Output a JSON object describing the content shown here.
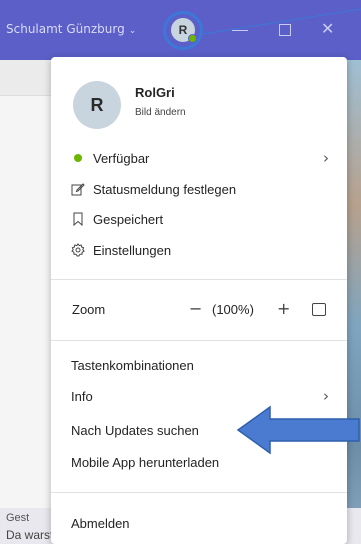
{
  "titlebar": {
    "org_name": "Schulamt Günzburg",
    "org_chevron": "⌄",
    "avatar_initial": "R",
    "status": "available"
  },
  "window": {
    "close_glyph": "✕"
  },
  "menu": {
    "profile": {
      "initial": "R",
      "name": "RolGri",
      "change_picture": "Bild ändern"
    },
    "status_items": [
      {
        "label": "Verfügbar",
        "icon": "green-dot",
        "chevron": "›"
      },
      {
        "label": "Statusmeldung festlegen",
        "icon": "edit-icon"
      },
      {
        "label": "Gespeichert",
        "icon": "bookmark-icon"
      },
      {
        "label": "Einstellungen",
        "icon": "gear-icon"
      }
    ],
    "zoom": {
      "label": "Zoom",
      "minus": "−",
      "value": "(100%)",
      "plus": "+"
    },
    "help_items": [
      {
        "label": "Tastenkombinationen"
      },
      {
        "label": "Info",
        "chevron": "›"
      },
      {
        "label": "Nach Updates suchen"
      },
      {
        "label": "Mobile App herunterladen"
      }
    ],
    "signout": "Abmelden"
  },
  "background": {
    "card_title": "Gest",
    "card_text": "Da warst du einen Tipp schneller"
  },
  "annotation": {
    "arrow_color": "#4a7bd0",
    "ring_color": "#3c78d8"
  }
}
